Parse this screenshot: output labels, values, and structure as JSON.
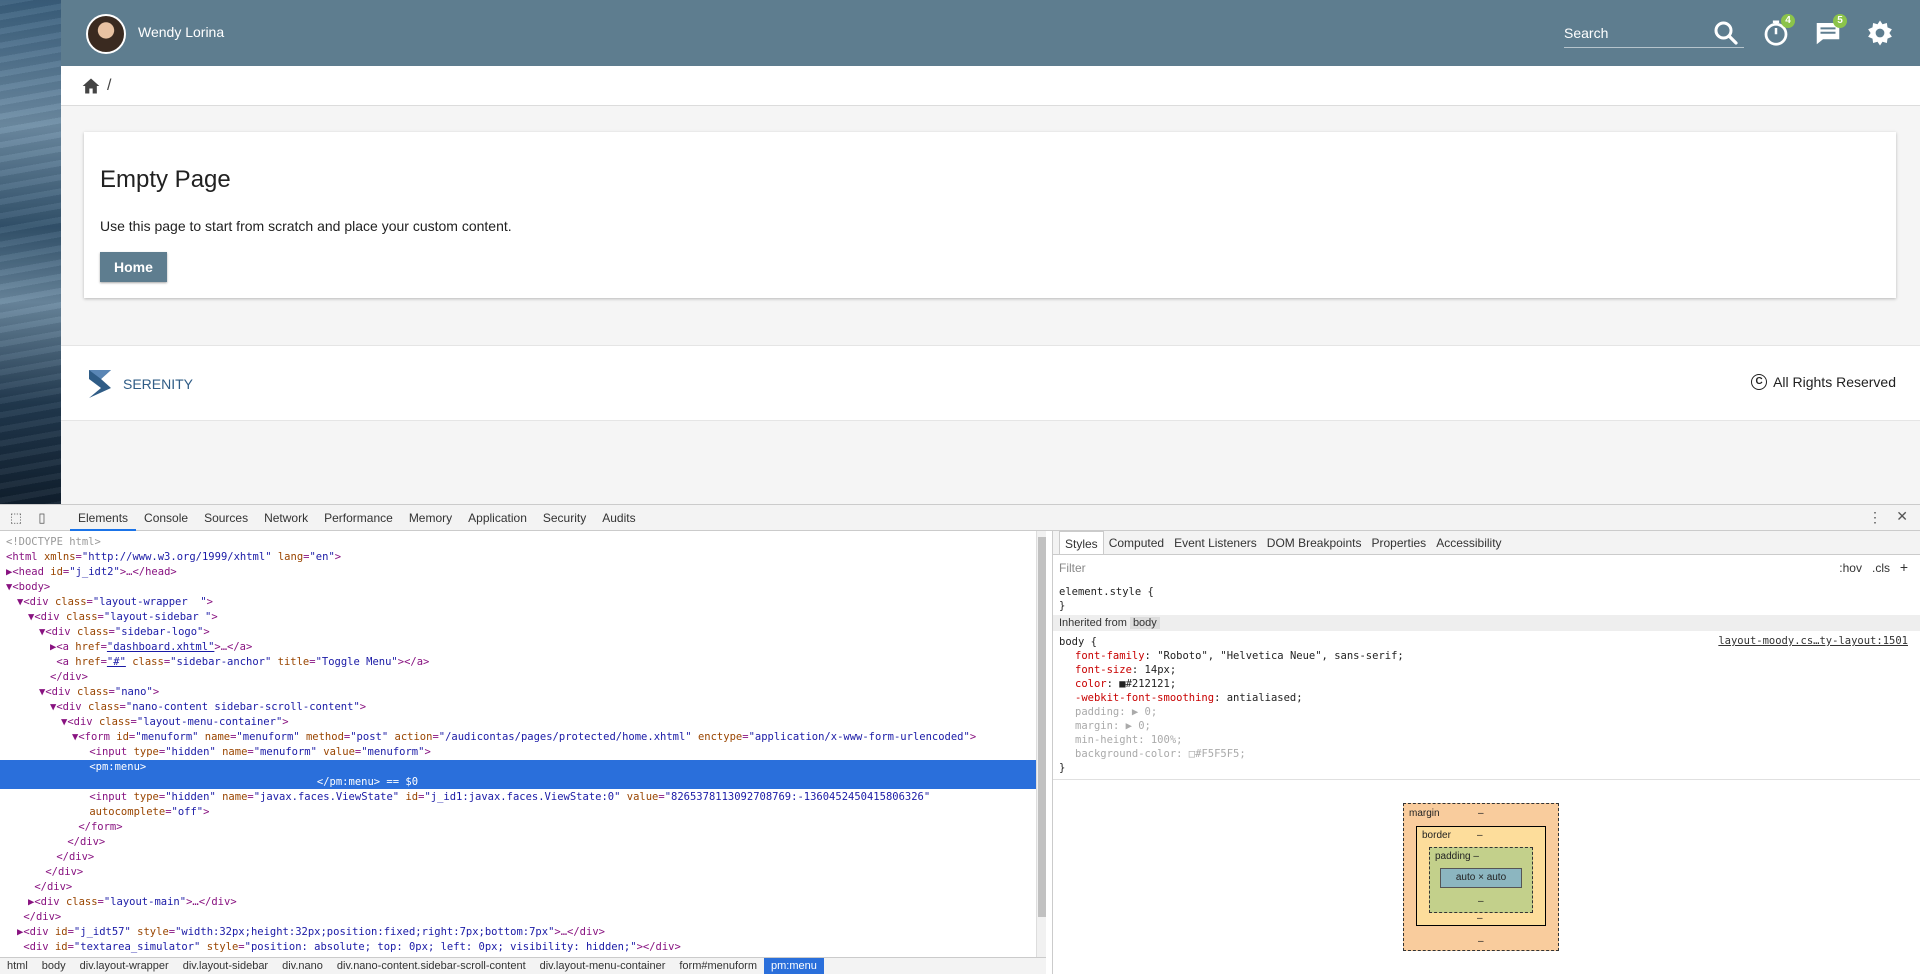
{
  "topbar": {
    "username": "Wendy Lorina",
    "search_placeholder": "Search",
    "timer_badge": "4",
    "messages_badge": "5",
    "bar_color": "#5e7d8f",
    "badge_color": "#8bc34a"
  },
  "breadcrumb": {
    "separator": "/"
  },
  "card": {
    "title": "Empty Page",
    "text": "Use this page to start from scratch and place your custom content.",
    "button": "Home"
  },
  "footer": {
    "brand": "SERENITY",
    "rights": "All Rights Reserved"
  },
  "devtools": {
    "tabs": [
      "Elements",
      "Console",
      "Sources",
      "Network",
      "Performance",
      "Memory",
      "Application",
      "Security",
      "Audits"
    ],
    "elements_lines": [
      {
        "indent": 1,
        "html": "<span class=\"gray\">&lt;!DOCTYPE html&gt;</span>"
      },
      {
        "indent": 1,
        "html": "&lt;html <span class=\"attr\">xmlns</span>=<span class=\"val\">\"http://www.w3.org/1999/xhtml\"</span> <span class=\"attr\">lang</span>=<span class=\"val\">\"en\"</span>&gt;"
      },
      {
        "indent": 1,
        "html": "▶&lt;head <span class=\"attr\">id</span>=<span class=\"val\">\"j_idt2\"</span>&gt;…&lt;/head&gt;"
      },
      {
        "indent": 1,
        "html": "▼&lt;body&gt;"
      },
      {
        "indent": 2,
        "html": "▼&lt;div <span class=\"attr\">class</span>=<span class=\"val\">\"layout-wrapper  \"</span>&gt;"
      },
      {
        "indent": 3,
        "html": "▼&lt;div <span class=\"attr\">class</span>=<span class=\"val\">\"layout-sidebar \"</span>&gt;"
      },
      {
        "indent": 4,
        "html": "▼&lt;div <span class=\"attr\">class</span>=<span class=\"val\">\"sidebar-logo\"</span>&gt;"
      },
      {
        "indent": 5,
        "html": "▶&lt;a <span class=\"attr\">href</span>=<span class=\"val\"><u>\"dashboard.xhtml\"</u></span>&gt;…&lt;/a&gt;"
      },
      {
        "indent": 5,
        "html": " &lt;a <span class=\"attr\">href</span>=<span class=\"val\"><u>\"#\"</u></span> <span class=\"attr\">class</span>=<span class=\"val\">\"sidebar-anchor\"</span> <span class=\"attr\">title</span>=<span class=\"val\">\"Toggle Menu\"</span>&gt;&lt;/a&gt;"
      },
      {
        "indent": 5,
        "html": "&lt;/div&gt;"
      },
      {
        "indent": 4,
        "html": "▼&lt;div <span class=\"attr\">class</span>=<span class=\"val\">\"nano\"</span>&gt;"
      },
      {
        "indent": 5,
        "html": "▼&lt;div <span class=\"attr\">class</span>=<span class=\"val\">\"nano-content sidebar-scroll-content\"</span>&gt;"
      },
      {
        "indent": 6,
        "html": "▼&lt;div <span class=\"attr\">class</span>=<span class=\"val\">\"layout-menu-container\"</span>&gt;"
      },
      {
        "indent": 7,
        "html": "▼&lt;form <span class=\"attr\">id</span>=<span class=\"val\">\"menuform\"</span> <span class=\"attr\">name</span>=<span class=\"val\">\"menuform\"</span> <span class=\"attr\">method</span>=<span class=\"val\">\"post\"</span> <span class=\"attr\">action</span>=<span class=\"val\">\"/audicontas/pages/protected/home.xhtml\"</span> <span class=\"attr\">enctype</span>=<span class=\"val\">\"application/x-www-form-urlencoded\"</span>&gt;"
      },
      {
        "indent": 8,
        "html": " &lt;input <span class=\"attr\">type</span>=<span class=\"val\">\"hidden\"</span> <span class=\"attr\">name</span>=<span class=\"val\">\"menuform\"</span> <span class=\"attr\">value</span>=<span class=\"val\">\"menuform\"</span>&gt;"
      },
      {
        "indent": 8,
        "html": " &lt;pm:menu&gt;\n                                     &lt;/pm:menu&gt; == $0",
        "selected": true
      },
      {
        "indent": 8,
        "html": " &lt;input <span class=\"attr\">type</span>=<span class=\"val\">\"hidden\"</span> <span class=\"attr\">name</span>=<span class=\"val\">\"javax.faces.ViewState\"</span> <span class=\"attr\">id</span>=<span class=\"val\">\"j_id1:javax.faces.ViewState:0\"</span> <span class=\"attr\">value</span>=<span class=\"val\">\"8265378113092708769:-1360452450415806326\"</span>"
      },
      {
        "indent": 8,
        "html": " <span class=\"attr\">autocomplete</span>=<span class=\"val\">\"off\"</span>&gt;"
      },
      {
        "indent": 7,
        "html": " &lt;/form&gt;"
      },
      {
        "indent": 6,
        "html": " &lt;/div&gt;"
      },
      {
        "indent": 5,
        "html": " &lt;/div&gt;"
      },
      {
        "indent": 4,
        "html": " &lt;/div&gt;"
      },
      {
        "indent": 3,
        "html": " &lt;/div&gt;"
      },
      {
        "indent": 3,
        "html": "▶&lt;div <span class=\"attr\">class</span>=<span class=\"val\">\"layout-main\"</span>&gt;…&lt;/div&gt;"
      },
      {
        "indent": 2,
        "html": " &lt;/div&gt;"
      },
      {
        "indent": 2,
        "html": "▶&lt;div <span class=\"attr\">id</span>=<span class=\"val\">\"j_idt57\"</span> <span class=\"attr\">style</span>=<span class=\"val\">\"width:32px;height:32px;position:fixed;right:7px;bottom:7px\"</span>&gt;…&lt;/div&gt;"
      },
      {
        "indent": 2,
        "html": " &lt;div <span class=\"attr\">id</span>=<span class=\"val\">\"textarea_simulator\"</span> <span class=\"attr\">style</span>=<span class=\"val\">\"position: absolute; top: 0px; left: 0px; visibility: hidden;\"</span>&gt;&lt;/div&gt;"
      }
    ],
    "crumbs": [
      "html",
      "body",
      "div.layout-wrapper",
      "div.layout-sidebar",
      "div.nano",
      "div.nano-content.sidebar-scroll-content",
      "div.layout-menu-container",
      "form#menuform",
      "pm:menu"
    ],
    "styles_tabs": [
      "Styles",
      "Computed",
      "Event Listeners",
      "DOM Breakpoints",
      "Properties",
      "Accessibility"
    ],
    "filter_placeholder": "Filter",
    "hov": ":hov",
    "cls": ".cls",
    "element_style": "element.style {\n}",
    "inherited_label": "Inherited from",
    "inherited_tag": "body",
    "rule_source": "layout-moody.cs…ty-layout:1501",
    "rule_selector": "body {",
    "rule_props": [
      {
        "name": "font-family",
        "value": "\"Roboto\", \"Helvetica Neue\", sans-serif;"
      },
      {
        "name": "font-size",
        "value": "14px;"
      },
      {
        "name": "color",
        "value": "■#212121;"
      },
      {
        "name": "-webkit-font-smoothing",
        "value": "antialiased;"
      },
      {
        "name": "padding",
        "value": "▶ 0;",
        "faded": true
      },
      {
        "name": "margin",
        "value": "▶ 0;",
        "faded": true
      },
      {
        "name": "min-height",
        "value": "100%;",
        "faded": true
      },
      {
        "name": "background-color",
        "value": "□#F5F5F5;",
        "faded": true
      }
    ],
    "rule_close": "}",
    "box_model": {
      "margin": "margin",
      "border": "border",
      "padding": "padding",
      "content": "auto × auto",
      "dash": "–"
    }
  }
}
